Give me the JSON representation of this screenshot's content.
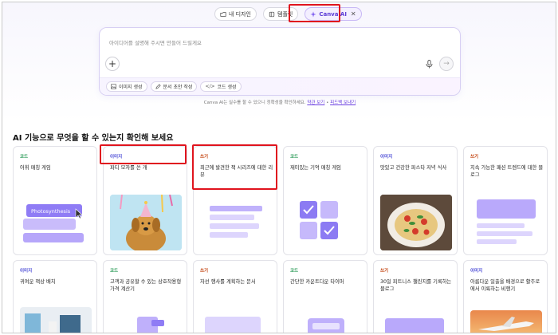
{
  "tabs": [
    {
      "label": "내 디자인",
      "icon": "folder-icon"
    },
    {
      "label": "템플릿",
      "icon": "template-icon"
    },
    {
      "label": "Canva AI",
      "icon": "sparkle-icon"
    }
  ],
  "prompt": {
    "placeholder": "아이디어를 설명해 주시면 만들어 드릴게요",
    "chips": [
      "이미지 생성",
      "문서 초안 작성",
      "코드 생성"
    ]
  },
  "disclaimer": {
    "text": "Canva AI는 실수를 할 수 있으니 정확성을 확인하세요.",
    "link1": "약관 보기",
    "sep": " • ",
    "link2": "피드백 보내기"
  },
  "section_title": "AI 기능으로 무엇을 할 수 있는지 확인해 보세요",
  "cards": [
    {
      "tag": "코드",
      "title": "어휘 매칭 게임",
      "illus_text": "Photosynthesis"
    },
    {
      "tag": "이미지",
      "title": "파티 모자를 쓴 개"
    },
    {
      "tag": "쓰기",
      "title": "최근에 발견한 책 시리즈에 대한 리뷰"
    },
    {
      "tag": "코드",
      "title": "재미있는 기억 매칭 게임"
    },
    {
      "tag": "이미지",
      "title": "맛있고 건강한 파스타 저녁 식사"
    },
    {
      "tag": "쓰기",
      "title": "지속 가능한 패션 트렌드에 대한 블로그"
    },
    {
      "tag": "이미지",
      "title": "귀여운 책상 배치"
    },
    {
      "tag": "코드",
      "title": "고객과 공유할 수 있는 상호작용형 가격 계산기"
    },
    {
      "tag": "쓰기",
      "title": "자선 행사를 계획하는 문서"
    },
    {
      "tag": "코드",
      "title": "간단한 카운트다운 타이머"
    },
    {
      "tag": "쓰기",
      "title": "30일 피트니스 챌린지를 기록하는 블로그"
    },
    {
      "tag": "이미지",
      "title": "아름다운 일출을 배경으로 활주로에서 이륙하는 비행기"
    }
  ]
}
